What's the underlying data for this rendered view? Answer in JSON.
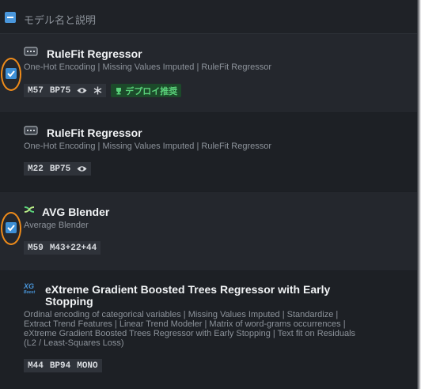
{
  "header": {
    "label": "モデル名と説明"
  },
  "rows": [
    {
      "title": "RuleFit Regressor",
      "description": "One-Hot Encoding | Missing Values Imputed | RuleFit Regressor",
      "model_id": "M57",
      "sample": "BP75",
      "deploy_badge": "デプロイ推奨",
      "selected": true,
      "icon": "rulefit-icon"
    },
    {
      "title": "RuleFit Regressor",
      "description": "One-Hot Encoding | Missing Values Imputed | RuleFit Regressor",
      "model_id": "M22",
      "sample": "BP75",
      "selected": false,
      "icon": "rulefit-icon"
    },
    {
      "title": "AVG Blender",
      "description": "Average Blender",
      "model_id": "M59",
      "sample": "M43+22+44",
      "selected": true,
      "icon": "blender-icon"
    },
    {
      "title": "eXtreme Gradient Boosted Trees Regressor with Early Stopping",
      "description": "Ordinal encoding of categorical variables | Missing Values Imputed | Standardize | Extract Trend Features | Linear Trend Modeler | Matrix of word-grams occurrences | eXtreme Gradient Boosted Trees Regressor with Early Stopping | Text fit on Residuals (L2 / Least-Squares Loss)",
      "model_id": "M44",
      "sample": "BP94",
      "tag3": "MONO",
      "selected": false,
      "icon": "xgboost-icon",
      "icon_text_1": "XG",
      "icon_text_2": "Boost"
    }
  ],
  "colors": {
    "checkbox": "#3d8fd6",
    "highlight": "#f08c1a",
    "deploy": "#5ad17a"
  }
}
